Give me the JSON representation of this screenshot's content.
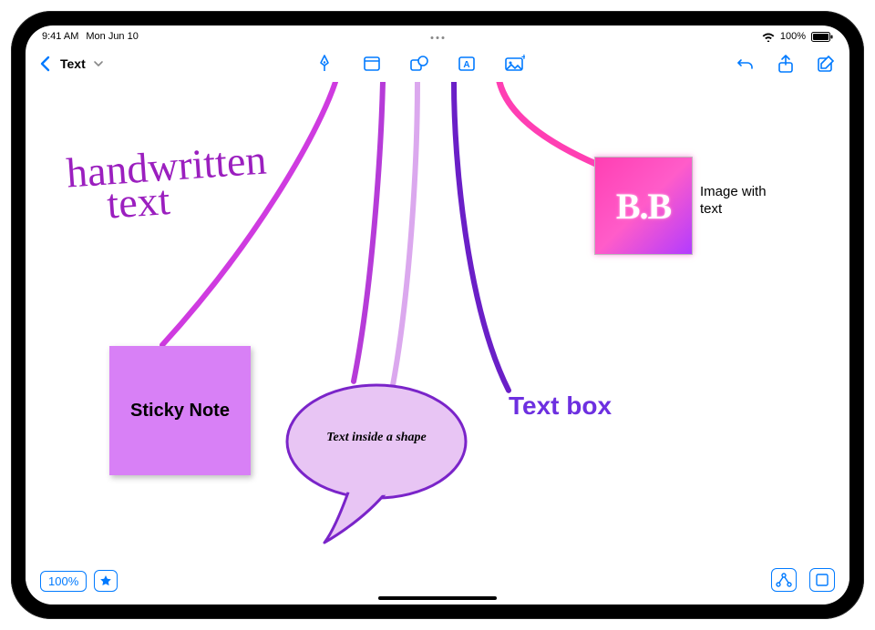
{
  "statusbar": {
    "time": "9:41 AM",
    "date": "Mon Jun 10",
    "battery_pct": "100%"
  },
  "toolbar": {
    "title": "Text"
  },
  "canvas": {
    "handwritten_line1": "handwritten",
    "handwritten_line2": "text",
    "sticky_label": "Sticky Note",
    "shape_text": "Text inside a shape",
    "textbox_label": "Text box",
    "image_inner": "B.B",
    "image_caption": "Image with text"
  },
  "footer": {
    "zoom": "100%"
  }
}
